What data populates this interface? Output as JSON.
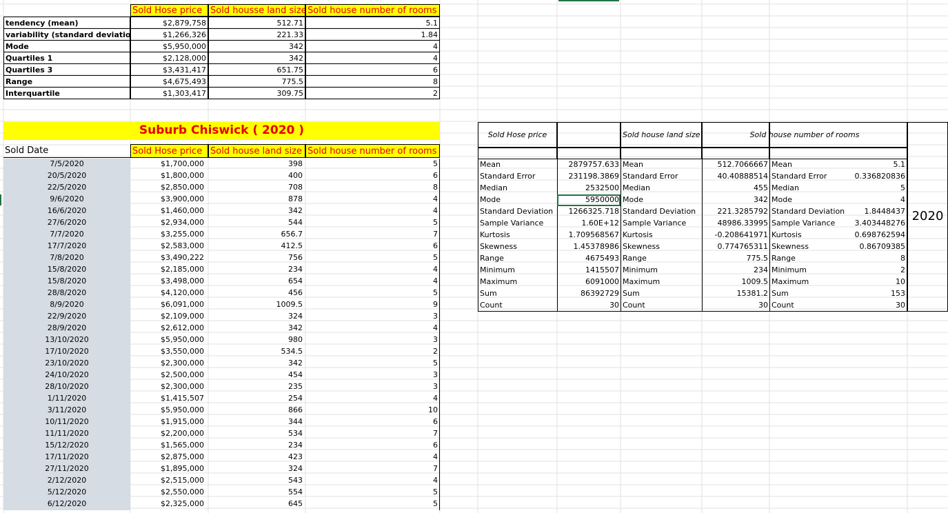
{
  "summary": {
    "headers": [
      "Sold Hose price",
      "Sold housse land size",
      "Sold house number of rooms"
    ],
    "rows": [
      {
        "label": "tendency (mean)",
        "price": "$2,879,758",
        "land": "512.71",
        "rooms": "5.1"
      },
      {
        "label": "variability (standard deviation)",
        "price": "$1,266,326",
        "land": "221.33",
        "rooms": "1.84"
      },
      {
        "label": "Mode",
        "price": "$5,950,000",
        "land": "342",
        "rooms": "4"
      },
      {
        "label": "Quartiles 1",
        "price": "$2,128,000",
        "land": "342",
        "rooms": "4"
      },
      {
        "label": "Quartiles 3",
        "price": "$3,431,417",
        "land": "651.75",
        "rooms": "6"
      },
      {
        "label": "Range",
        "price": "$4,675,493",
        "land": "775.5",
        "rooms": "8"
      },
      {
        "label": "Interquartile",
        "price": "$1,303,417",
        "land": "309.75",
        "rooms": "2"
      }
    ]
  },
  "main": {
    "title": "Suburb Chiswick ( 2020 )",
    "headers": [
      "Sold Date",
      "Sold Hose price",
      "Sold house  land size",
      "Sold house number of rooms"
    ],
    "rows": [
      [
        "7/5/2020",
        "$1,700,000",
        "398",
        "5"
      ],
      [
        "20/5/2020",
        "$1,800,000",
        "400",
        "6"
      ],
      [
        "22/5/2020",
        "$2,850,000",
        "708",
        "8"
      ],
      [
        "9/6/2020",
        "$3,900,000",
        "878",
        "4"
      ],
      [
        "16/6/2020",
        "$1,460,000",
        "342",
        "4"
      ],
      [
        "27/6/2020",
        "$2,934,000",
        "544",
        "5"
      ],
      [
        "7/7/2020",
        "$3,255,000",
        "656.7",
        "7"
      ],
      [
        "17/7/2020",
        "$2,583,000",
        "412.5",
        "6"
      ],
      [
        "7/8/2020",
        "$3,490,222",
        "756",
        "5"
      ],
      [
        "15/8/2020",
        "$2,185,000",
        "234",
        "4"
      ],
      [
        "15/8/2020",
        "$3,498,000",
        "654",
        "4"
      ],
      [
        "28/8/2020",
        "$4,120,000",
        "456",
        "5"
      ],
      [
        "8/9/2020",
        "$6,091,000",
        "1009.5",
        "9"
      ],
      [
        "22/9/2020",
        "$2,109,000",
        "324",
        "3"
      ],
      [
        "28/9/2020",
        "$2,612,000",
        "342",
        "4"
      ],
      [
        "13/10/2020",
        "$5,950,000",
        "980",
        "3"
      ],
      [
        "17/10/2020",
        "$3,550,000",
        "534.5",
        "2"
      ],
      [
        "23/10/2020",
        "$2,300,000",
        "342",
        "5"
      ],
      [
        "24/10/2020",
        "$2,500,000",
        "454",
        "3"
      ],
      [
        "28/10/2020",
        "$2,300,000",
        "235",
        "3"
      ],
      [
        "1/11/2020",
        "$1,415,507",
        "254",
        "4"
      ],
      [
        "3/11/2020",
        "$5,950,000",
        "866",
        "10"
      ],
      [
        "10/11/2020",
        "$1,915,000",
        "344",
        "6"
      ],
      [
        "11/11/2020",
        "$2,200,000",
        "534",
        "7"
      ],
      [
        "15/12/2020",
        "$1,565,000",
        "234",
        "6"
      ],
      [
        "17/11/2020",
        "$2,875,000",
        "423",
        "4"
      ],
      [
        "27/11/2020",
        "$1,895,000",
        "324",
        "7"
      ],
      [
        "2/12/2020",
        "$2,515,000",
        "543",
        "4"
      ],
      [
        "5/12/2020",
        "$2,550,000",
        "554",
        "5"
      ],
      [
        "6/12/2020",
        "$2,325,000",
        "645",
        "5"
      ]
    ]
  },
  "stats": {
    "headers": [
      "Sold Hose price",
      "Sold house  land size",
      "Sold house number of rooms"
    ],
    "year": "2020",
    "rows": [
      [
        "Mean",
        "2879757.633",
        "Mean",
        "512.7066667",
        "Mean",
        "5.1"
      ],
      [
        "Standard Error",
        "231198.3869",
        "Standard Error",
        "40.40888514",
        "Standard Error",
        "0.336820836"
      ],
      [
        "Median",
        "2532500",
        "Median",
        "455",
        "Median",
        "5"
      ],
      [
        "Mode",
        "5950000",
        "Mode",
        "342",
        "Mode",
        "4"
      ],
      [
        "Standard Deviation",
        "1266325.718",
        "Standard Deviation",
        "221.3285792",
        "Standard Deviation",
        "1.8448437"
      ],
      [
        "Sample Variance",
        "1.60E+12",
        "Sample Variance",
        "48986.33995",
        "Sample Variance",
        "3.403448276"
      ],
      [
        "Kurtosis",
        "1.709568567",
        "Kurtosis",
        "-0.208641971",
        "Kurtosis",
        "0.698762594"
      ],
      [
        "Skewness",
        "1.45378986",
        "Skewness",
        "0.774765311",
        "Skewness",
        "0.86709385"
      ],
      [
        "Range",
        "4675493",
        "Range",
        "775.5",
        "Range",
        "8"
      ],
      [
        "Minimum",
        "1415507",
        "Minimum",
        "234",
        "Minimum",
        "2"
      ],
      [
        "Maximum",
        "6091000",
        "Maximum",
        "1009.5",
        "Maximum",
        "10"
      ],
      [
        "Sum",
        "86392729",
        "Sum",
        "15381.2",
        "Sum",
        "153"
      ],
      [
        "Count",
        "30",
        "Count",
        "30",
        "Count",
        "30"
      ]
    ]
  }
}
